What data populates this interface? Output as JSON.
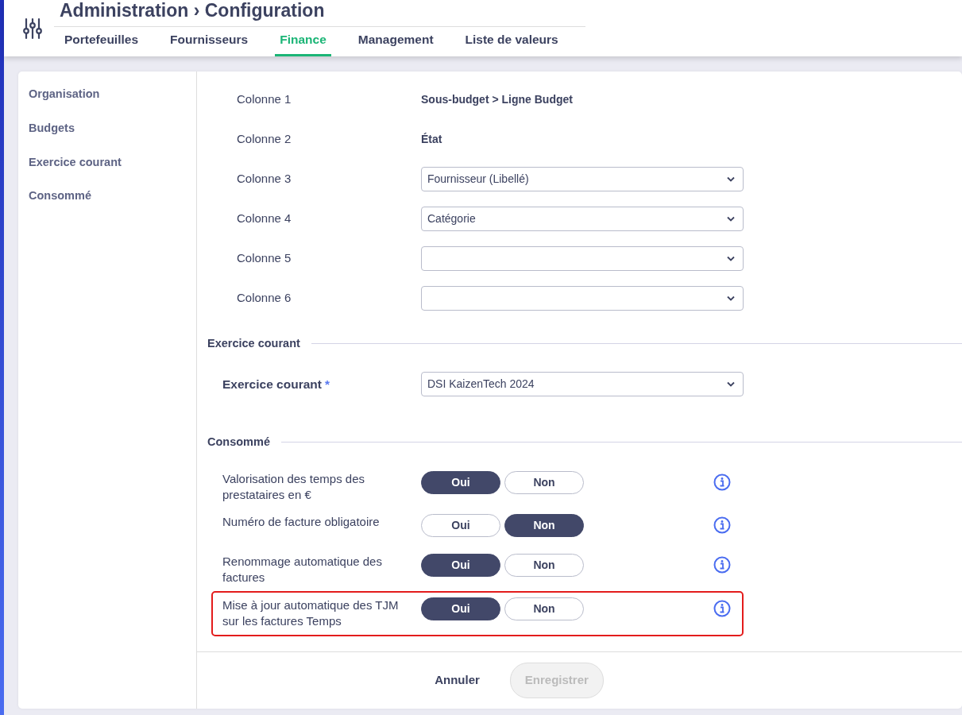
{
  "header": {
    "title_parts": [
      "Administration",
      "Configuration"
    ],
    "separator": "›"
  },
  "tabs": [
    {
      "label": "Portefeuilles",
      "selected": false
    },
    {
      "label": "Fournisseurs",
      "selected": false
    },
    {
      "label": "Finance",
      "selected": true
    },
    {
      "label": "Management",
      "selected": false
    },
    {
      "label": "Liste de valeurs",
      "selected": false
    }
  ],
  "sidebar": {
    "items": [
      "Organisation",
      "Budgets",
      "Exercice courant",
      "Consommé"
    ]
  },
  "columns": [
    {
      "label": "Colonne 1",
      "kind": "text",
      "value": "Sous-budget > Ligne Budget"
    },
    {
      "label": "Colonne 2",
      "kind": "text",
      "value": "État"
    },
    {
      "label": "Colonne 3",
      "kind": "select",
      "value": "Fournisseur (Libellé)"
    },
    {
      "label": "Colonne 4",
      "kind": "select",
      "value": "Catégorie"
    },
    {
      "label": "Colonne 5",
      "kind": "select"
    },
    {
      "label": "Colonne 6",
      "kind": "select"
    }
  ],
  "exercice": {
    "section_title": "Exercice courant",
    "label": "Exercice courant",
    "required_mark": "*",
    "value": "DSI KaizenTech 2024"
  },
  "consomme": {
    "section_title": "Consommé",
    "settings": [
      {
        "label": "Valorisation des temps des prestataires en €",
        "highlighted": false,
        "options": [
          {
            "label": "Oui",
            "selected": true
          },
          {
            "label": "Non",
            "selected": false
          }
        ]
      },
      {
        "label": "Numéro de facture obligatoire",
        "highlighted": false,
        "options": [
          {
            "label": "Oui",
            "selected": false
          },
          {
            "label": "Non",
            "selected": true
          }
        ]
      },
      {
        "label": "Renommage automatique des factures",
        "highlighted": false,
        "options": [
          {
            "label": "Oui",
            "selected": true
          },
          {
            "label": "Non",
            "selected": false
          }
        ]
      },
      {
        "label": "Mise à jour automatique des TJM sur les factures Temps",
        "highlighted": true,
        "options": [
          {
            "label": "Oui",
            "selected": true
          },
          {
            "label": "Non",
            "selected": false
          }
        ]
      }
    ]
  },
  "footer": {
    "buttons": [
      {
        "label": "Annuler",
        "disabled": false
      },
      {
        "label": "Enregistrer",
        "disabled": true
      }
    ]
  }
}
